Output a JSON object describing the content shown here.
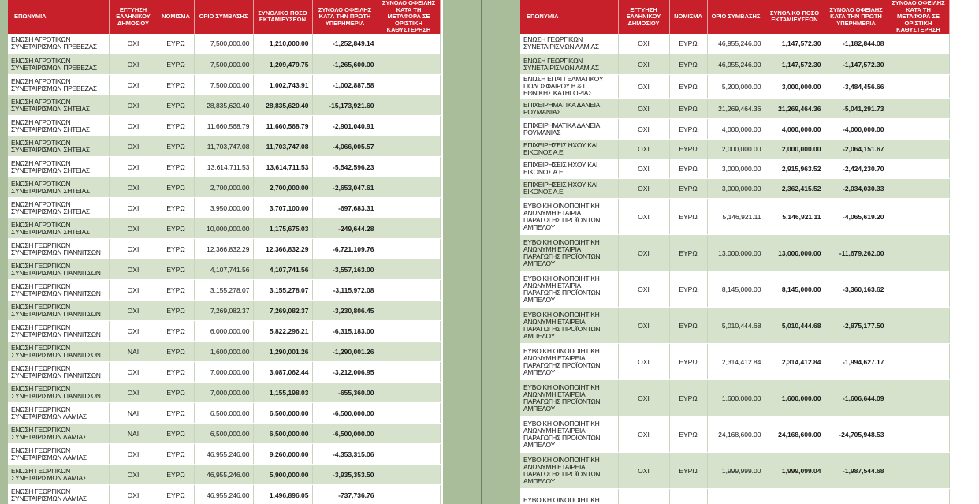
{
  "headers": [
    "ΕΠΩΝΥΜΙΑ",
    "ΕΓΓΥΗΣΗ ΕΛΛΗΝΙΚΟΥ ΔΗΜΟΣΙΟΥ",
    "ΝΟΜΙΣΜΑ",
    "ΟΡΙΟ ΣΥΜΒΑΣΗΣ",
    "ΣΥΝΟΛΙΚΟ ΠΟΣΟ ΕΚΤΑΜΙΕΥΣΕΩΝ",
    "ΣΥΝΟΛΟ ΟΦΕΙΛΗΣ ΚΑΤΑ ΤΗΝ ΠΡΩΤΗ ΥΠΕΡΗΜΕΡΙΑ",
    "ΣΥΝΟΛΟ ΟΦΕΙΛΗΣ ΚΑΤΑ ΤΗ ΜΕΤΑΦΟΡΑ ΣΕ ΟΡΙΣΤΙΚΗ ΚΑΘΥΣΤΕΡΗΣΗ"
  ],
  "left_rows": [
    [
      "ΕΝΩΣΗ ΑΓΡΟΤΙΚΩΝ ΣΥΝΕΤΑΙΡΙΣΜΩΝ ΠΡΕΒΕΖΑΣ",
      "ΟΧΙ",
      "ΕΥΡΩ",
      "7,500,000.00",
      "1,210,000.00",
      "-1,252,849.14",
      ""
    ],
    [
      "ΕΝΩΣΗ ΑΓΡΟΤΙΚΩΝ ΣΥΝΕΤΑΙΡΙΣΜΩΝ ΠΡΕΒΕΖΑΣ",
      "ΟΧΙ",
      "ΕΥΡΩ",
      "7,500,000.00",
      "1,209,479.75",
      "-1,265,600.00",
      ""
    ],
    [
      "ΕΝΩΣΗ ΑΓΡΟΤΙΚΩΝ ΣΥΝΕΤΑΙΡΙΣΜΩΝ ΠΡΕΒΕΖΑΣ",
      "ΟΧΙ",
      "ΕΥΡΩ",
      "7,500,000.00",
      "1,002,743.91",
      "-1,002,887.58",
      ""
    ],
    [
      "ΕΝΩΣΗ ΑΓΡΟΤΙΚΩΝ ΣΥΝΕΤΑΙΡΙΣΜΩΝ ΣΗΤΕΙΑΣ",
      "ΟΧΙ",
      "ΕΥΡΩ",
      "28,835,620.40",
      "28,835,620.40",
      "-15,173,921.60",
      ""
    ],
    [
      "ΕΝΩΣΗ ΑΓΡΟΤΙΚΩΝ ΣΥΝΕΤΑΙΡΙΣΜΩΝ ΣΗΤΕΙΑΣ",
      "ΟΧΙ",
      "ΕΥΡΩ",
      "11,660,568.79",
      "11,660,568.79",
      "-2,901,040.91",
      ""
    ],
    [
      "ΕΝΩΣΗ ΑΓΡΟΤΙΚΩΝ ΣΥΝΕΤΑΙΡΙΣΜΩΝ ΣΗΤΕΙΑΣ",
      "ΟΧΙ",
      "ΕΥΡΩ",
      "11,703,747.08",
      "11,703,747.08",
      "-4,066,005.57",
      ""
    ],
    [
      "ΕΝΩΣΗ ΑΓΡΟΤΙΚΩΝ ΣΥΝΕΤΑΙΡΙΣΜΩΝ ΣΗΤΕΙΑΣ",
      "ΟΧΙ",
      "ΕΥΡΩ",
      "13,614,711.53",
      "13,614,711.53",
      "-5,542,596.23",
      ""
    ],
    [
      "ΕΝΩΣΗ ΑΓΡΟΤΙΚΩΝ ΣΥΝΕΤΑΙΡΙΣΜΩΝ ΣΗΤΕΙΑΣ",
      "ΟΧΙ",
      "ΕΥΡΩ",
      "2,700,000.00",
      "2,700,000.00",
      "-2,653,047.61",
      ""
    ],
    [
      "ΕΝΩΣΗ ΑΓΡΟΤΙΚΩΝ ΣΥΝΕΤΑΙΡΙΣΜΩΝ ΣΗΤΕΙΑΣ",
      "ΟΧΙ",
      "ΕΥΡΩ",
      "3,950,000.00",
      "3,707,100.00",
      "-697,683.31",
      ""
    ],
    [
      "ΕΝΩΣΗ ΑΓΡΟΤΙΚΩΝ ΣΥΝΕΤΑΙΡΙΣΜΩΝ ΣΗΤΕΙΑΣ",
      "ΟΧΙ",
      "ΕΥΡΩ",
      "10,000,000.00",
      "1,175,675.03",
      "-249,644.28",
      ""
    ],
    [
      "ΕΝΩΣΗ ΓΕΩΡΓΙΚΩΝ ΣΥΝΕΤΑΙΡΙΣΜΩΝ ΓΙΑΝΝΙΤΣΩΝ",
      "ΟΧΙ",
      "ΕΥΡΩ",
      "12,366,832.29",
      "12,366,832.29",
      "-6,721,109.76",
      ""
    ],
    [
      "ΕΝΩΣΗ ΓΕΩΡΓΙΚΩΝ ΣΥΝΕΤΑΙΡΙΣΜΩΝ ΓΙΑΝΝΙΤΣΩΝ",
      "ΟΧΙ",
      "ΕΥΡΩ",
      "4,107,741.56",
      "4,107,741.56",
      "-3,557,163.00",
      ""
    ],
    [
      "ΕΝΩΣΗ ΓΕΩΡΓΙΚΩΝ ΣΥΝΕΤΑΙΡΙΣΜΩΝ ΓΙΑΝΝΙΤΣΩΝ",
      "ΟΧΙ",
      "ΕΥΡΩ",
      "3,155,278.07",
      "3,155,278.07",
      "-3,115,972.08",
      ""
    ],
    [
      "ΕΝΩΣΗ ΓΕΩΡΓΙΚΩΝ ΣΥΝΕΤΑΙΡΙΣΜΩΝ ΓΙΑΝΝΙΤΣΩΝ",
      "ΟΧΙ",
      "ΕΥΡΩ",
      "7,269,082.37",
      "7,269,082.37",
      "-3,230,806.45",
      ""
    ],
    [
      "ΕΝΩΣΗ ΓΕΩΡΓΙΚΩΝ ΣΥΝΕΤΑΙΡΙΣΜΩΝ ΓΙΑΝΝΙΤΣΩΝ",
      "ΟΧΙ",
      "ΕΥΡΩ",
      "6,000,000.00",
      "5,822,296.21",
      "-6,315,183.00",
      ""
    ],
    [
      "ΕΝΩΣΗ ΓΕΩΡΓΙΚΩΝ ΣΥΝΕΤΑΙΡΙΣΜΩΝ ΓΙΑΝΝΙΤΣΩΝ",
      "ΝΑΙ",
      "ΕΥΡΩ",
      "1,600,000.00",
      "1,290,001.26",
      "-1,290,001.26",
      ""
    ],
    [
      "ΕΝΩΣΗ ΓΕΩΡΓΙΚΩΝ ΣΥΝΕΤΑΙΡΙΣΜΩΝ ΓΙΑΝΝΙΤΣΩΝ",
      "ΟΧΙ",
      "ΕΥΡΩ",
      "7,000,000.00",
      "3,087,062.44",
      "-3,212,006.95",
      ""
    ],
    [
      "ΕΝΩΣΗ ΓΕΩΡΓΙΚΩΝ ΣΥΝΕΤΑΙΡΙΣΜΩΝ ΓΙΑΝΝΙΤΣΩΝ",
      "ΟΧΙ",
      "ΕΥΡΩ",
      "7,000,000.00",
      "1,155,198.03",
      "-655,360.00",
      ""
    ],
    [
      "ΕΝΩΣΗ ΓΕΩΡΓΙΚΩΝ ΣΥΝΕΤΑΙΡΙΣΜΩΝ ΛΑΜΙΑΣ",
      "ΝΑΙ",
      "ΕΥΡΩ",
      "6,500,000.00",
      "6,500,000.00",
      "-6,500,000.00",
      ""
    ],
    [
      "ΕΝΩΣΗ ΓΕΩΡΓΙΚΩΝ ΣΥΝΕΤΑΙΡΙΣΜΩΝ ΛΑΜΙΑΣ",
      "ΝΑΙ",
      "ΕΥΡΩ",
      "6,500,000.00",
      "6,500,000.00",
      "-6,500,000.00",
      ""
    ],
    [
      "ΕΝΩΣΗ ΓΕΩΡΓΙΚΩΝ ΣΥΝΕΤΑΙΡΙΣΜΩΝ ΛΑΜΙΑΣ",
      "ΟΧΙ",
      "ΕΥΡΩ",
      "46,955,246.00",
      "9,260,000.00",
      "-4,353,315.06",
      ""
    ],
    [
      "ΕΝΩΣΗ ΓΕΩΡΓΙΚΩΝ ΣΥΝΕΤΑΙΡΙΣΜΩΝ ΛΑΜΙΑΣ",
      "ΟΧΙ",
      "ΕΥΡΩ",
      "46,955,246.00",
      "5,900,000.00",
      "-3,935,353.50",
      ""
    ],
    [
      "ΕΝΩΣΗ ΓΕΩΡΓΙΚΩΝ ΣΥΝΕΤΑΙΡΙΣΜΩΝ ΛΑΜΙΑΣ",
      "ΟΧΙ",
      "ΕΥΡΩ",
      "46,955,246.00",
      "1,496,896.05",
      "-737,736.76",
      ""
    ]
  ],
  "right_rows": [
    [
      "ΕΝΩΣΗ ΓΕΩΡΓΙΚΩΝ ΣΥΝΕΤΑΙΡΙΣΜΩΝ ΛΑΜΙΑΣ",
      "ΟΧΙ",
      "ΕΥΡΩ",
      "46,955,246.00",
      "1,147,572.30",
      "-1,182,844.08",
      ""
    ],
    [
      "ΕΝΩΣΗ ΓΕΩΡΓΙΚΩΝ ΣΥΝΕΤΑΙΡΙΣΜΩΝ ΛΑΜΙΑΣ",
      "ΟΧΙ",
      "ΕΥΡΩ",
      "46,955,246.00",
      "1,147,572.30",
      "-1,147,572.30",
      ""
    ],
    [
      "ΕΝΩΣΗ ΕΠΑΓΓΕΛΜΑΤΙΚΟΥ ΠΟΔΟΣΦΑΙΡΟΥ Β & Γ ΕΘΝΙΚΗΣ ΚΑΤΗΓΟΡΙΑΣ",
      "ΟΧΙ",
      "ΕΥΡΩ",
      "5,200,000.00",
      "3,000,000.00",
      "-3,484,456.66",
      ""
    ],
    [
      "ΕΠΙΧΕΙΡΗΜΑΤΙΚΑ ΔΑΝΕΙΑ ΡΟΥΜΑΝΙΑΣ",
      "ΟΧΙ",
      "ΕΥΡΩ",
      "21,269,464.36",
      "21,269,464.36",
      "-5,041,291.73",
      ""
    ],
    [
      "ΕΠΙΧΕΙΡΗΜΑΤΙΚΑ ΔΑΝΕΙΑ ΡΟΥΜΑΝΙΑΣ",
      "ΟΧΙ",
      "ΕΥΡΩ",
      "4,000,000.00",
      "4,000,000.00",
      "-4,000,000.00",
      ""
    ],
    [
      "ΕΠΙΧΕΙΡΗΣΕΙΣ ΗΧΟΥ ΚΑΙ ΕΙΚΟΝΟΣ Α.Ε.",
      "ΟΧΙ",
      "ΕΥΡΩ",
      "2,000,000.00",
      "2,000,000.00",
      "-2,064,151.67",
      ""
    ],
    [
      "ΕΠΙΧΕΙΡΗΣΕΙΣ ΗΧΟΥ ΚΑΙ ΕΙΚΟΝΟΣ Α.Ε.",
      "ΟΧΙ",
      "ΕΥΡΩ",
      "3,000,000.00",
      "2,915,963.52",
      "-2,424,230.70",
      ""
    ],
    [
      "ΕΠΙΧΕΙΡΗΣΕΙΣ ΗΧΟΥ ΚΑΙ ΕΙΚΟΝΟΣ Α.Ε.",
      "ΟΧΙ",
      "ΕΥΡΩ",
      "3,000,000.00",
      "2,362,415.52",
      "-2,034,030.33",
      ""
    ],
    [
      "ΕΥΒΟΙΚΗ ΟΙΝΟΠΟΙΗΤΙΚΗ ΑΝΩΝΥΜΗ ΕΤΑΙΡΙΑ ΠΑΡΑΓΩΓΗΣ ΠΡΟΪΟΝΤΩΝ ΑΜΠΕΛΟΥ",
      "ΟΧΙ",
      "ΕΥΡΩ",
      "5,146,921.11",
      "5,146,921.11",
      "-4,065,619.20",
      ""
    ],
    [
      "ΕΥΒΟΙΚΗ ΟΙΝΟΠΟΙΗΤΙΚΗ ΑΝΩΝΥΜΗ ΕΤΑΙΡΙΑ ΠΑΡΑΓΩΓΗΣ ΠΡΟΪΟΝΤΩΝ ΑΜΠΕΛΟΥ",
      "ΟΧΙ",
      "ΕΥΡΩ",
      "13,000,000.00",
      "13,000,000.00",
      "-11,679,262.00",
      ""
    ],
    [
      "ΕΥΒΟΙΚΗ ΟΙΝΟΠΟΙΗΤΙΚΗ ΑΝΩΝΥΜΗ ΕΤΑΙΡΙΑ ΠΑΡΑΓΩΓΗΣ ΠΡΟΪΟΝΤΩΝ ΑΜΠΕΛΟΥ",
      "ΟΧΙ",
      "ΕΥΡΩ",
      "8,145,000.00",
      "8,145,000.00",
      "-3,360,163.62",
      ""
    ],
    [
      "ΕΥΒΟΙΚΗ ΟΙΝΟΠΟΙΗΤΙΚΗ ΑΝΩΝΥΜΗ ΕΤΑΙΡΕΙΑ ΠΑΡΑΓΩΓΗΣ ΠΡΟΪΟΝΤΩΝ ΑΜΠΕΛΟΥ",
      "ΟΧΙ",
      "ΕΥΡΩ",
      "5,010,444.68",
      "5,010,444.68",
      "-2,875,177.50",
      ""
    ],
    [
      "ΕΥΒΟΙΚΗ ΟΙΝΟΠΟΙΗΤΙΚΗ ΑΝΩΝΥΜΗ ΕΤΑΙΡΕΙΑ ΠΑΡΑΓΩΓΗΣ ΠΡΟΪΟΝΤΩΝ ΑΜΠΕΛΟΥ",
      "ΟΧΙ",
      "ΕΥΡΩ",
      "2,314,412.84",
      "2,314,412.84",
      "-1,994,627.17",
      ""
    ],
    [
      "ΕΥΒΟΙΚΗ ΟΙΝΟΠΟΙΗΤΙΚΗ ΑΝΩΝΥΜΗ ΕΤΑΙΡΕΙΑ ΠΑΡΑΓΩΓΗΣ ΠΡΟΪΟΝΤΩΝ ΑΜΠΕΛΟΥ",
      "ΟΧΙ",
      "ΕΥΡΩ",
      "1,600,000.00",
      "1,600,000.00",
      "-1,606,644.09",
      ""
    ],
    [
      "ΕΥΒΟΙΚΗ ΟΙΝΟΠΟΙΗΤΙΚΗ ΑΝΩΝΥΜΗ ΕΤΑΙΡΕΙΑ ΠΑΡΑΓΩΓΗΣ ΠΡΟΪΟΝΤΩΝ ΑΜΠΕΛΟΥ",
      "ΟΧΙ",
      "ΕΥΡΩ",
      "24,168,600.00",
      "24,168,600.00",
      "-24,705,948.53",
      ""
    ],
    [
      "ΕΥΒΟΙΚΗ ΟΙΝΟΠΟΙΗΤΙΚΗ ΑΝΩΝΥΜΗ ΕΤΑΙΡΕΙΑ ΠΑΡΑΓΩΓΗΣ ΠΡΟΪΟΝΤΩΝ ΑΜΠΕΛΟΥ",
      "ΟΧΙ",
      "ΕΥΡΩ",
      "1,999,999.00",
      "1,999,099.04",
      "-1,987,544.68",
      ""
    ],
    [
      "ΕΥΒΟΙΚΗ ΟΙΝΟΠΟΙΗΤΙΚΗ",
      "",
      "",
      "",
      "",
      "",
      ""
    ]
  ]
}
